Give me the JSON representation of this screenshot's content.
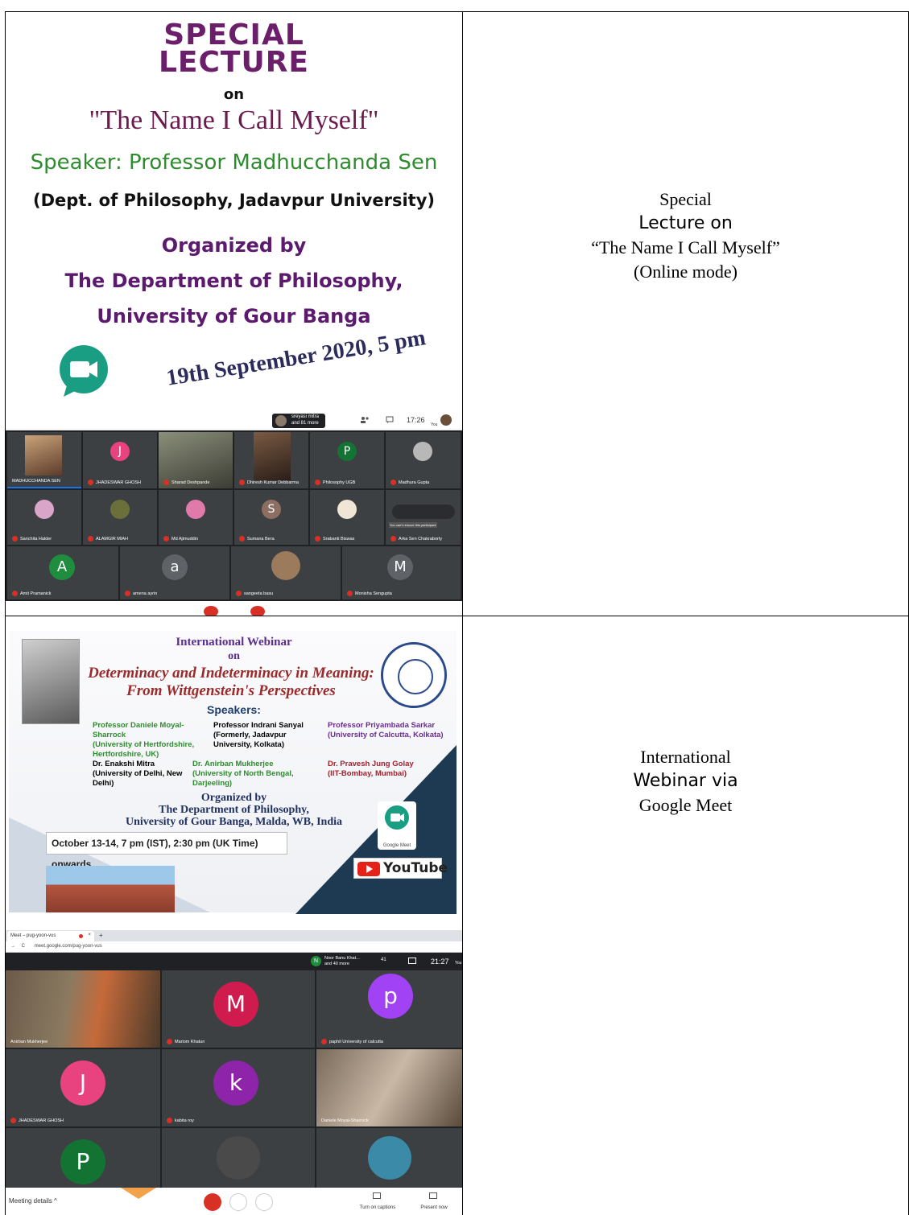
{
  "row1": {
    "poster": {
      "heading": "SPECIAL\nLECTURE",
      "on": "on",
      "title": "\"The Name I Call Myself\"",
      "speaker": "Speaker: Professor Madhucchanda Sen",
      "dept": "(Dept. of Philosophy, Jadavpur University)",
      "organized_line1": "Organized by",
      "organized_line2": "The Department of Philosophy,",
      "organized_line3": "University of Gour Banga",
      "date": "19th September 2020, 5 pm"
    },
    "meet": {
      "chip_line1": "sreyasi mitra",
      "chip_line2": "and 81 more",
      "time": "17:26",
      "you": "You",
      "participants": [
        "MADHUCCHANDA SEN",
        "JHADESWAR GHOSH",
        "Sharad Deshpande",
        "Dhiresh Kumar Debbarma",
        "Philosophy UGB",
        "Madhura Gupta",
        "Sanchita Halder",
        "ALAMGIR MIAH",
        "Md Ajimuddin",
        "Sumana Bera",
        "Srabanti Biswas",
        "Arka Sen Chakraborty",
        "Amit Pramanick",
        "amena ayrin",
        "sangeeta basu",
        "Monisha Sengupta"
      ],
      "initials": {
        "j": "J",
        "p": "P",
        "s": "S",
        "a": "A",
        "a2": "a",
        "m": "M"
      },
      "tooltip": "You can't remove this participant"
    },
    "caption": {
      "line1": "Special",
      "line2": "Lecture on",
      "line3": "“The Name I  Call Myself”",
      "line4": "(Online  mode)"
    }
  },
  "row2": {
    "poster": {
      "head1": "International Webinar",
      "head2": "on",
      "title": "Determinacy and Indeterminacy in Meaning: From Wittgenstein's Perspectives",
      "speakers_label": "Speakers:",
      "speakers": [
        {
          "name": "Professor Daniele Moyal-Sharrock",
          "aff": "(University of Hertfordshire, Hertfordshire, UK)",
          "color": "#2e8b2e"
        },
        {
          "name": "Professor Indrani Sanyal",
          "aff": "(Formerly, Jadavpur University, Kolkata)",
          "color": "#111111"
        },
        {
          "name": "Professor Priyambada Sarkar",
          "aff": "(University of Calcutta, Kolkata)",
          "color": "#6a2c91"
        },
        {
          "name": "Dr. Enakshi Mitra",
          "aff": "(University of Delhi, New Delhi)",
          "color": "#111111"
        },
        {
          "name": "Dr. Anirban Mukherjee",
          "aff": "(University of North Bengal, Darjeeling)",
          "color": "#2e8b2e"
        },
        {
          "name": "Dr. Pravesh Jung Golay",
          "aff": "(IIT-Bombay, Mumbai)",
          "color": "#a31f2a"
        }
      ],
      "org1": "Organized by",
      "org2": "The Department of Philosophy,",
      "org3": "University of Gour Banga, Malda, WB, India",
      "date": "October 13-14, 7 pm (IST), 2:30 pm (UK Time) onwards",
      "google_meet": "Google Meet",
      "youtube": "YouTube"
    },
    "meet": {
      "tab_title": "Meet – pug-yoon-vus",
      "url": "meet.google.com/pug-yoon-vus",
      "chip_initial": "N",
      "chip_line1": "Noor Banu Khat...",
      "chip_line2": "and 40 more",
      "count": "41",
      "time": "21:27",
      "you": "You",
      "participants": [
        "Anirban Mukherjee",
        "Mariom Khatun",
        "paphil University of calcutta",
        "JHADESWAR GHOSH",
        "kabita roy",
        "Daniele Moyal-Sharrock"
      ],
      "initials": {
        "m": "M",
        "p": "p",
        "j": "J",
        "k": "k",
        "p2": "P"
      },
      "meeting_details": "Meeting details",
      "captions": "Turn on captions",
      "present": "Present now"
    },
    "caption": {
      "line1": "International",
      "line2": "Webinar via",
      "line3": "Google Meet"
    }
  }
}
